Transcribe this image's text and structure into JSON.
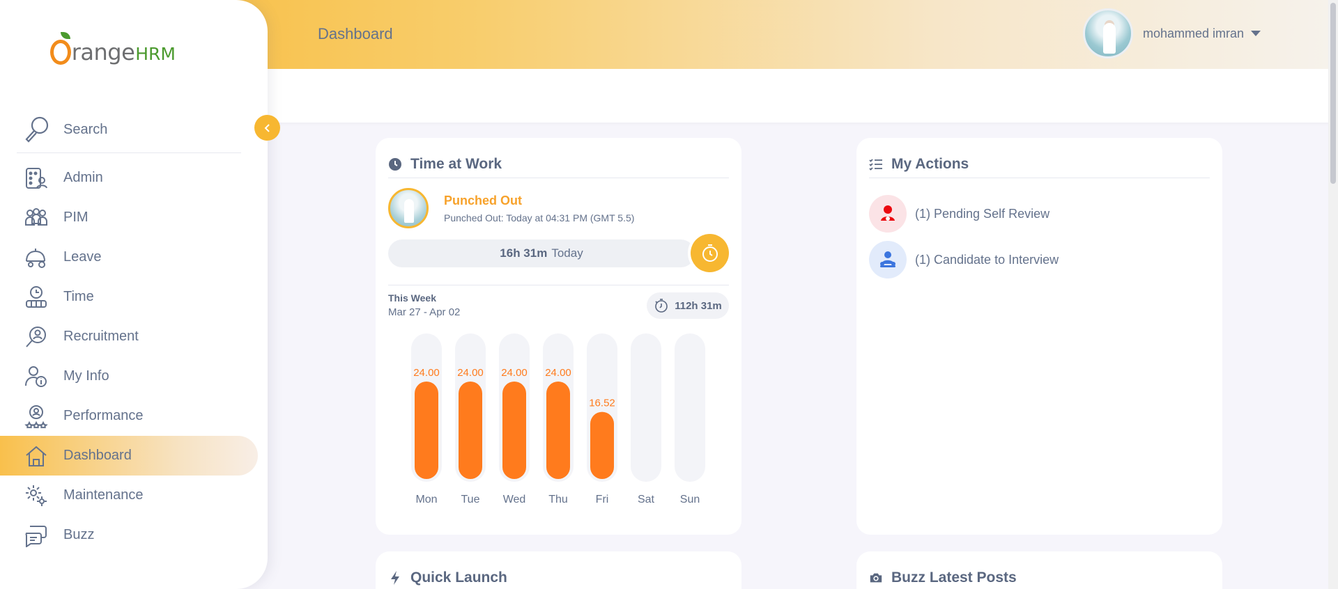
{
  "brand": {
    "word": "range",
    "suffix": "HRM"
  },
  "sidebar": {
    "search_label": "Search",
    "items": [
      {
        "label": "Admin",
        "icon": "admin-icon"
      },
      {
        "label": "PIM",
        "icon": "pim-icon"
      },
      {
        "label": "Leave",
        "icon": "leave-icon"
      },
      {
        "label": "Time",
        "icon": "time-icon"
      },
      {
        "label": "Recruitment",
        "icon": "recruitment-icon"
      },
      {
        "label": "My Info",
        "icon": "my-info-icon"
      },
      {
        "label": "Performance",
        "icon": "performance-icon"
      },
      {
        "label": "Dashboard",
        "icon": "dashboard-icon",
        "active": true
      },
      {
        "label": "Maintenance",
        "icon": "maintenance-icon"
      },
      {
        "label": "Buzz",
        "icon": "buzz-icon"
      }
    ]
  },
  "header": {
    "title": "Dashboard",
    "user_name": "mohammed imran"
  },
  "colors": {
    "accent": "#f7b731",
    "bar": "#ff7b1d",
    "text": "#64728c"
  },
  "time_at_work": {
    "title": "Time at Work",
    "status": "Punched Out",
    "status_detail": "Punched Out: Today at 04:31 PM (GMT 5.5)",
    "today_hours": "16h 31m",
    "today_label": "Today",
    "week_label": "This Week",
    "week_range": "Mar 27 - Apr 02",
    "week_total": "112h 31m"
  },
  "chart_data": {
    "type": "bar",
    "categories": [
      "Mon",
      "Tue",
      "Wed",
      "Thu",
      "Fri",
      "Sat",
      "Sun"
    ],
    "values": [
      24.0,
      24.0,
      24.0,
      24.0,
      16.52,
      0,
      0
    ],
    "labels": [
      "24.00",
      "24.00",
      "24.00",
      "24.00",
      "16.52",
      "",
      ""
    ],
    "ylim": [
      0,
      30
    ],
    "title": "",
    "xlabel": "",
    "ylabel": ""
  },
  "my_actions": {
    "title": "My Actions",
    "items": [
      {
        "label": "(1) Pending Self Review",
        "icon": "self-review-icon"
      },
      {
        "label": "(1) Candidate to Interview",
        "icon": "candidate-icon"
      }
    ]
  },
  "quick_launch": {
    "title": "Quick Launch"
  },
  "buzz": {
    "title": "Buzz Latest Posts"
  }
}
